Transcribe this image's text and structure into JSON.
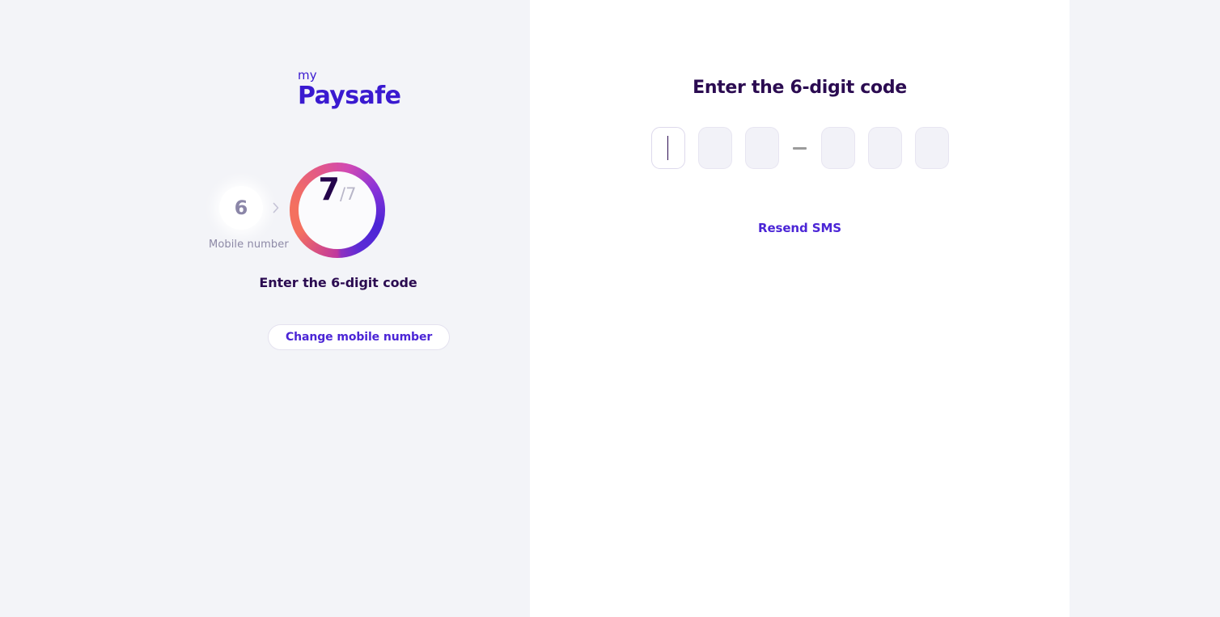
{
  "brand": {
    "prefix": "my",
    "name": "Paysafe",
    "color": "#3a1ad0"
  },
  "colors": {
    "panel_bg": "#f3f4f8",
    "panel_white": "#ffffff",
    "heading": "#2b0b51",
    "accent": "#4b25d6",
    "muted": "#8d89a6",
    "ring_start": "#f4705f",
    "ring_end": "#4b25d6",
    "separator": "#9b9b9b"
  },
  "stepper": {
    "previous": {
      "number": "6",
      "label": "Mobile number"
    },
    "chevron_icon": "chevron-right-icon",
    "current": {
      "number": "7",
      "total": "/7"
    },
    "caption": "Enter the 6-digit code"
  },
  "left_actions": {
    "change_mobile_label": "Change mobile number"
  },
  "main": {
    "heading": "Enter the 6-digit code",
    "otp": {
      "length": 6,
      "separator": "—",
      "focused_index": 0,
      "values": [
        "",
        "",
        "",
        "",
        "",
        ""
      ],
      "placeholder": ""
    },
    "resend_label": "Resend SMS"
  }
}
